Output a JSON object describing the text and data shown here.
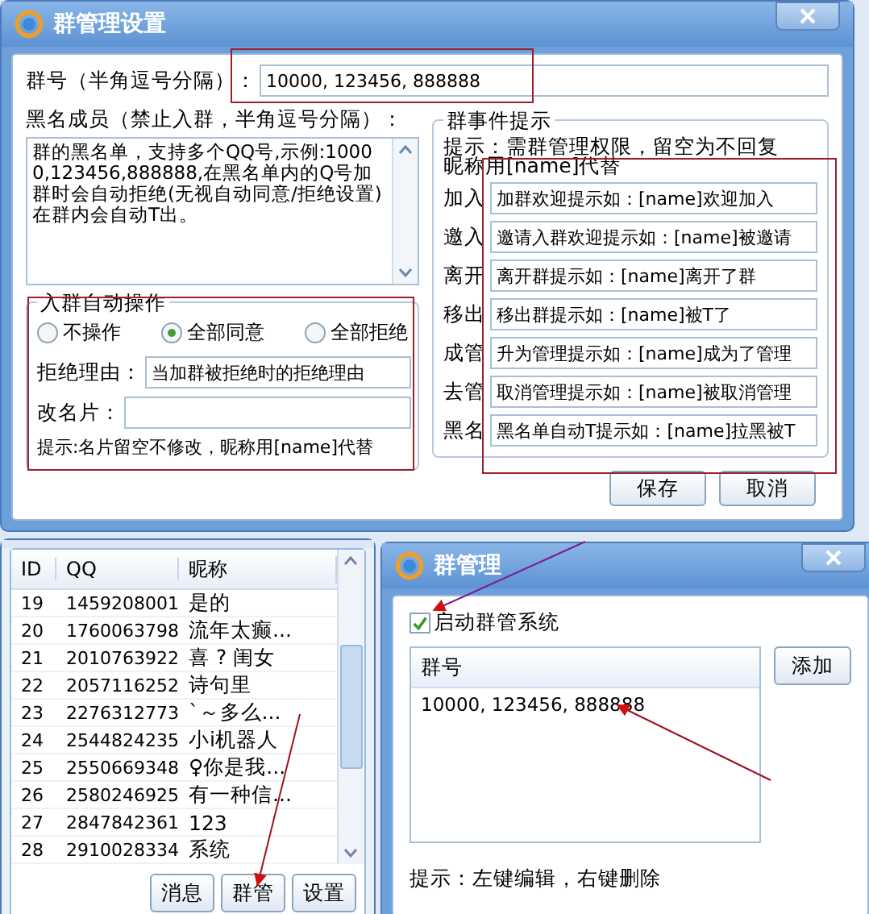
{
  "main_dialog": {
    "title": "群管理设置",
    "group_field": {
      "label": "群号（半角逗号分隔）：",
      "value": "10000, 123456, 888888"
    },
    "blacklist": {
      "label": "黑名成员（禁止入群，半角逗号分隔）：",
      "value": "群的黑名单，支持多个QQ号,示例:10000,123456,888888,在黑名单内的Q号加群时会自动拒绝(无视自动同意/拒绝设置)在群内会自动T出。"
    },
    "auto_action": {
      "title": "入群自动操作",
      "options": [
        {
          "label": "不操作",
          "selected": false
        },
        {
          "label": "全部同意",
          "selected": true
        },
        {
          "label": "全部拒绝",
          "selected": false
        }
      ],
      "reject_reason": {
        "label": "拒绝理由：",
        "value": "当加群被拒绝时的拒绝理由"
      },
      "card": {
        "label": "改名片："
      },
      "hint": "提示:名片留空不修改，昵称用[name]代替"
    },
    "events": {
      "title": "群事件提示",
      "hint_lines": [
        "提示：需群管理权限，留空为不回复",
        "昵称用[name]代替"
      ],
      "rows": [
        {
          "label": "加入",
          "value": "加群欢迎提示如：[name]欢迎加入"
        },
        {
          "label": "邀入",
          "value": "邀请入群欢迎提示如：[name]被邀请"
        },
        {
          "label": "离开",
          "value": "离开群提示如：[name]离开了群"
        },
        {
          "label": "移出",
          "value": "移出群提示如：[name]被T了"
        },
        {
          "label": "成管",
          "value": "升为管理提示如：[name]成为了管理"
        },
        {
          "label": "去管",
          "value": "取消管理提示如：[name]被取消管理"
        },
        {
          "label": "黑名",
          "value": "黑名单自动T提示如：[name]拉黑被T"
        }
      ]
    },
    "buttons": [
      "保存",
      "取消"
    ]
  },
  "list_window": {
    "columns": [
      "ID",
      "QQ",
      "昵称"
    ],
    "rows": [
      [
        "19",
        "1459208001",
        "是的"
      ],
      [
        "20",
        "1760063798",
        "流年太癫..."
      ],
      [
        "21",
        "2010763922",
        "喜 ? 闺女"
      ],
      [
        "22",
        "2057116252",
        "诗句里"
      ],
      [
        "23",
        "2276312773",
        "ˋ～多么..."
      ],
      [
        "24",
        "2544824235",
        "小i机器人"
      ],
      [
        "25",
        "2550669348",
        "♀你是我..."
      ],
      [
        "26",
        "2580246925",
        "有一种信..."
      ],
      [
        "27",
        "2847842361",
        "123"
      ],
      [
        "28",
        "2910028334",
        "系统"
      ]
    ],
    "buttons": [
      "消息",
      "群管",
      "设置"
    ]
  },
  "group_dialog": {
    "title": "群管理",
    "enable": {
      "label": "启动群管系统",
      "checked": true
    },
    "table": {
      "columns": [
        "群号"
      ],
      "rows": [
        "10000, 123456, 888888"
      ]
    },
    "add_button": "添加",
    "hint": "提示：左键编辑，右键删除"
  }
}
